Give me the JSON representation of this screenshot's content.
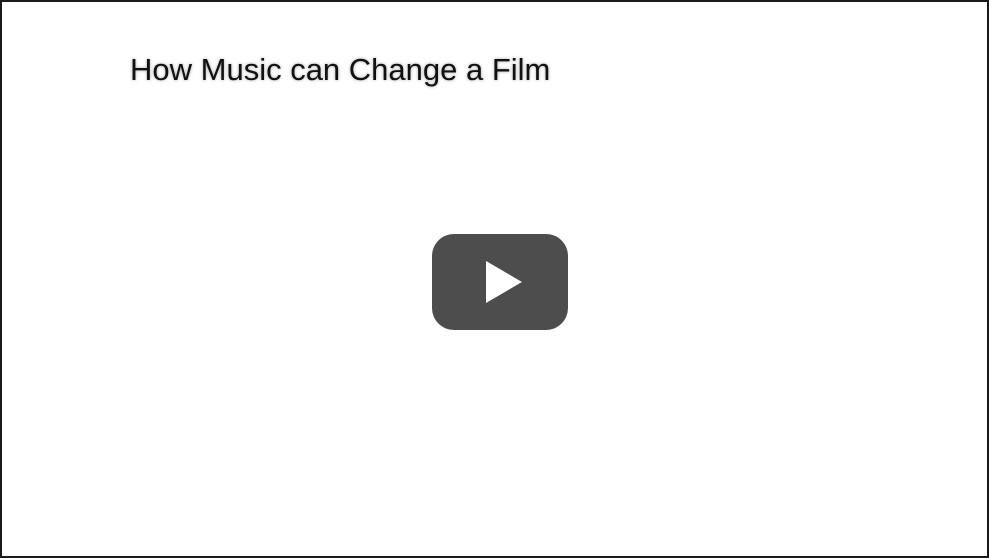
{
  "video": {
    "title": "How Music can Change a Film",
    "play_icon": "play-icon",
    "play_button_color": "#4d4d4d",
    "play_triangle_color": "#ffffff",
    "border_color": "#1a1a1a"
  }
}
